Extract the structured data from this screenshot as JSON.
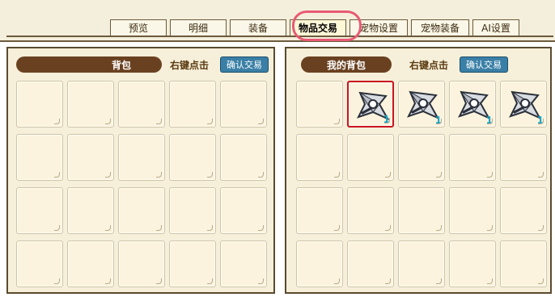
{
  "tabs": [
    {
      "label": "预览",
      "active": false
    },
    {
      "label": "明细",
      "active": false
    },
    {
      "label": "装备",
      "active": false
    },
    {
      "label": "物品交易",
      "active": true
    },
    {
      "label": "宠物设置",
      "active": false
    },
    {
      "label": "宠物装备",
      "active": false
    },
    {
      "label": "AI设置",
      "active": false
    }
  ],
  "left_panel": {
    "title": "背包",
    "hint": "右键点击",
    "confirm_label": "确认交易"
  },
  "right_panel": {
    "title": "我的背包",
    "hint": "右键点击",
    "confirm_label": "确认交易",
    "items": [
      {
        "slot": 1,
        "name": "shuriken-icon",
        "qty": "1"
      },
      {
        "slot": 2,
        "name": "shuriken-icon",
        "qty": "1"
      },
      {
        "slot": 3,
        "name": "shuriken-icon",
        "qty": "1"
      },
      {
        "slot": 4,
        "name": "shuriken-icon",
        "qty": "1"
      }
    ]
  },
  "colors": {
    "header_pill": "#6a4120",
    "confirm_button": "#3a7fa6",
    "selected_border": "#c8141e",
    "quantity_text": "#1aa6c8",
    "highlight_ring": "#e85a73"
  }
}
